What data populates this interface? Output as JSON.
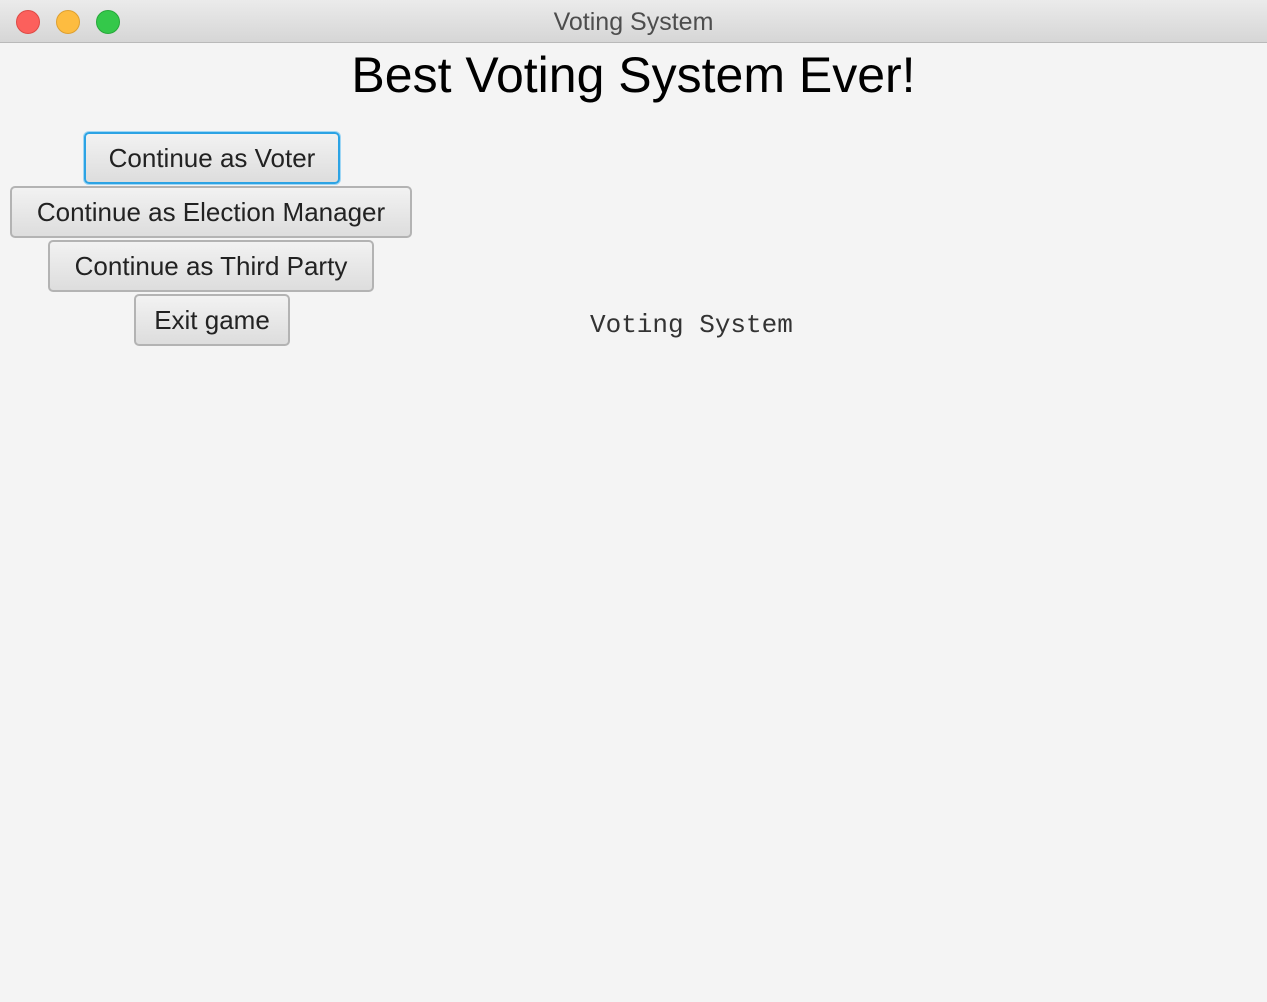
{
  "window": {
    "title": "Voting System",
    "controls": {
      "close_icon": "close-circle-icon",
      "minimize_icon": "minimize-circle-icon",
      "zoom_icon": "zoom-circle-icon",
      "close_color": "#fc605c",
      "minimize_color": "#fdbc40",
      "zoom_color": "#34c84a"
    }
  },
  "main": {
    "heading": "Best Voting System Ever!",
    "buttons": {
      "voter": "Continue as Voter",
      "election_manager": "Continue as Election Manager",
      "third_party": "Continue as Third Party",
      "exit": "Exit game"
    },
    "focused_button": "voter",
    "side_label": "Voting System"
  },
  "colors": {
    "background": "#f4f4f4",
    "focus_ring": "#2ca3e4"
  }
}
